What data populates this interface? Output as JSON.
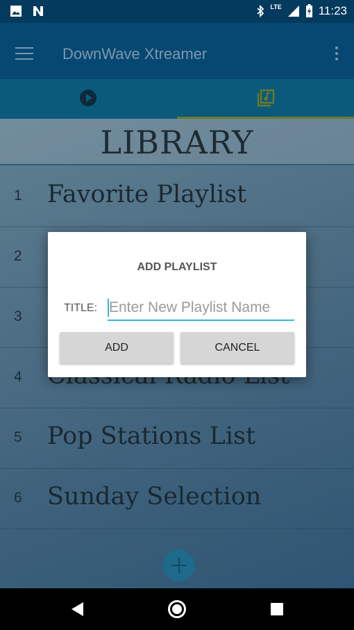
{
  "status_bar": {
    "time": "11:23",
    "network": "LTE"
  },
  "app_bar": {
    "title": "DownWave Xtreamer"
  },
  "tabs": [
    {
      "icon": "play-icon"
    },
    {
      "icon": "library-music-icon",
      "selected": true
    }
  ],
  "library": {
    "title": "LIBRARY",
    "items": [
      {
        "num": "1",
        "name": "Favorite Playlist"
      },
      {
        "num": "2",
        "name": ""
      },
      {
        "num": "3",
        "name": ""
      },
      {
        "num": "4",
        "name": "Classical Radio List"
      },
      {
        "num": "5",
        "name": "Pop Stations List"
      },
      {
        "num": "6",
        "name": "Sunday Selection"
      }
    ]
  },
  "dialog": {
    "title": "ADD PLAYLIST",
    "field_label": "TITLE:",
    "field_placeholder": "Enter New Playlist Name",
    "field_value": "",
    "add_label": "ADD",
    "cancel_label": "CANCEL"
  },
  "colors": {
    "accent": "#33b6e0",
    "app_bar": "#064872",
    "tab_indicator": "#6d7a26"
  }
}
